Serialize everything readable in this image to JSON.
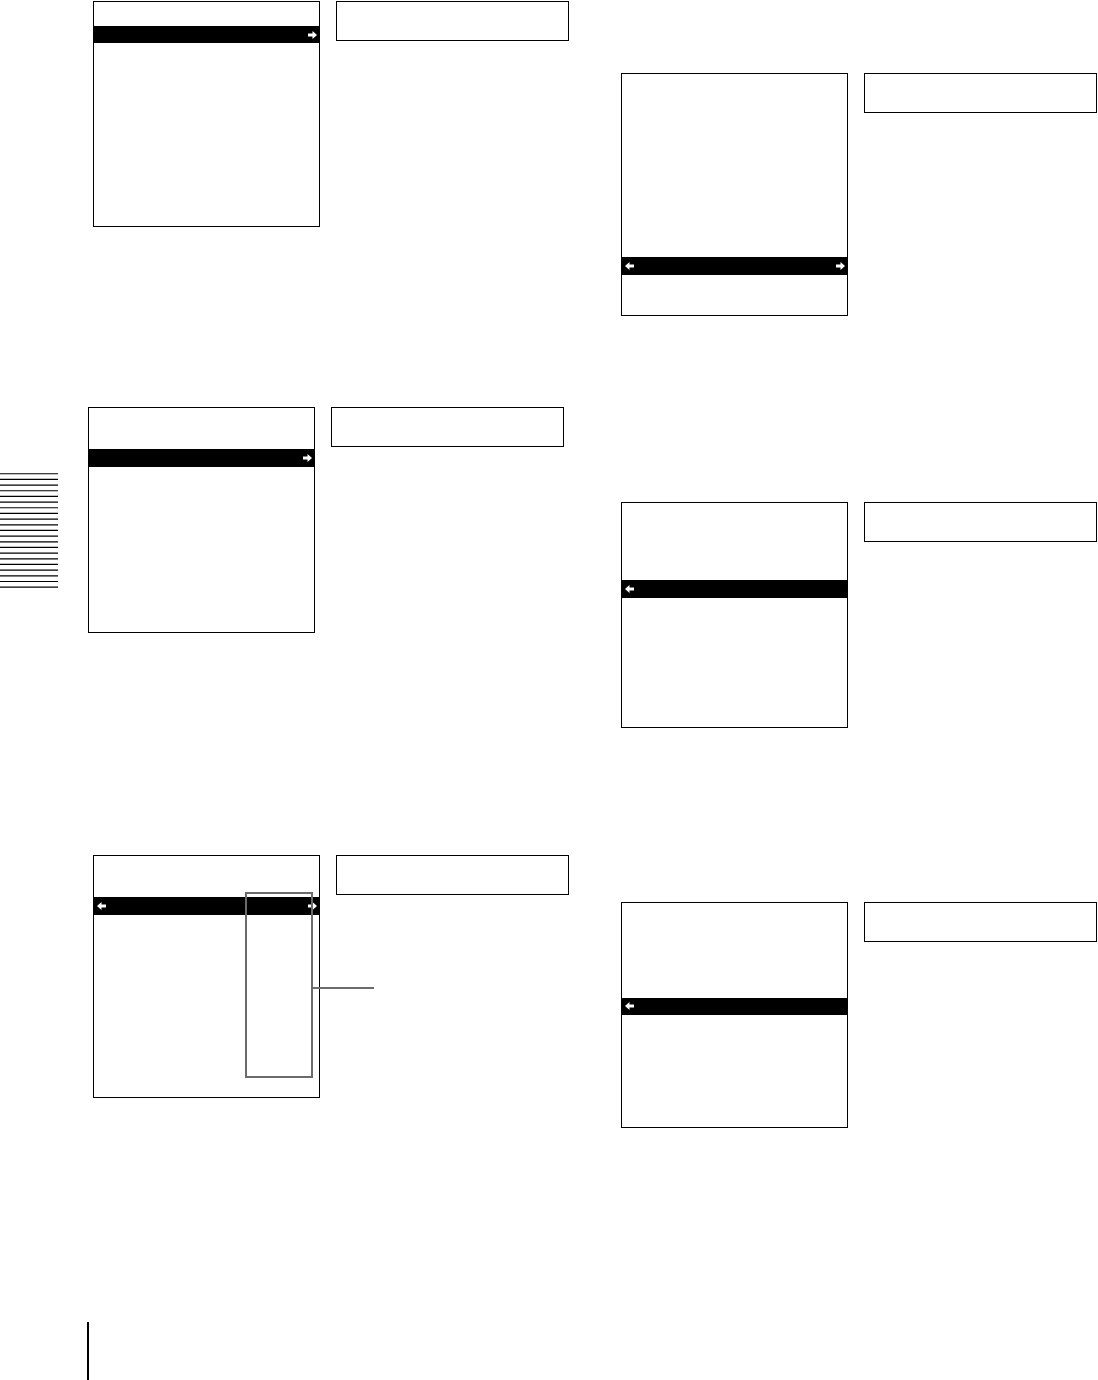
{
  "screens": [
    {
      "rows": [
        {
          "selected": false
        },
        {
          "selected": true
        },
        {
          "selected": false
        },
        {
          "selected": false
        },
        {
          "selected": false
        },
        {
          "selected": false
        },
        {
          "selected": false
        },
        {
          "selected": false
        },
        {
          "selected": false
        },
        {
          "selected": false
        },
        {
          "selected": false
        },
        {
          "selected": false
        }
      ],
      "arrow_left": false,
      "arrow_right": true,
      "callout": false
    },
    {
      "rows": [
        {
          "selected": false
        },
        {
          "selected": false
        },
        {
          "selected": false
        },
        {
          "selected": false
        },
        {
          "selected": false
        },
        {
          "selected": false
        },
        {
          "selected": false
        },
        {
          "selected": false
        },
        {
          "selected": false
        },
        {
          "selected": false
        },
        {
          "selected": true
        },
        {
          "selected": false
        },
        {
          "selected": false
        }
      ],
      "arrow_left": true,
      "arrow_right": true,
      "callout": false
    },
    {
      "rows": [
        {
          "selected": false
        },
        {
          "selected": false
        },
        {
          "selected": true
        },
        {
          "selected": false
        },
        {
          "selected": false
        },
        {
          "selected": false
        },
        {
          "selected": false
        },
        {
          "selected": false
        },
        {
          "selected": false
        },
        {
          "selected": false
        },
        {
          "selected": false
        },
        {
          "selected": false
        }
      ],
      "arrow_left": false,
      "arrow_right": true,
      "callout": false
    },
    {
      "rows": [
        {
          "selected": false
        },
        {
          "selected": false
        },
        {
          "selected": false
        },
        {
          "selected": false
        },
        {
          "selected": true
        },
        {
          "selected": false
        },
        {
          "selected": false
        },
        {
          "selected": false
        },
        {
          "selected": false
        },
        {
          "selected": false
        },
        {
          "selected": false
        },
        {
          "selected": false
        }
      ],
      "arrow_left": true,
      "arrow_right": false,
      "callout": false
    },
    {
      "rows": [
        {
          "selected": false
        },
        {
          "selected": false
        },
        {
          "selected": true
        },
        {
          "selected": false
        },
        {
          "selected": false
        },
        {
          "selected": false
        },
        {
          "selected": false
        },
        {
          "selected": false
        },
        {
          "selected": false
        },
        {
          "selected": false
        },
        {
          "selected": false
        },
        {
          "selected": false
        },
        {
          "selected": false
        }
      ],
      "arrow_left": true,
      "arrow_right": true,
      "callout": true
    },
    {
      "rows": [
        {
          "selected": false
        },
        {
          "selected": false
        },
        {
          "selected": false
        },
        {
          "selected": false
        },
        {
          "selected": false
        },
        {
          "selected": true
        },
        {
          "selected": false
        },
        {
          "selected": false
        },
        {
          "selected": false
        },
        {
          "selected": false
        },
        {
          "selected": false
        },
        {
          "selected": false
        }
      ],
      "arrow_left": true,
      "arrow_right": false,
      "callout": false
    }
  ]
}
